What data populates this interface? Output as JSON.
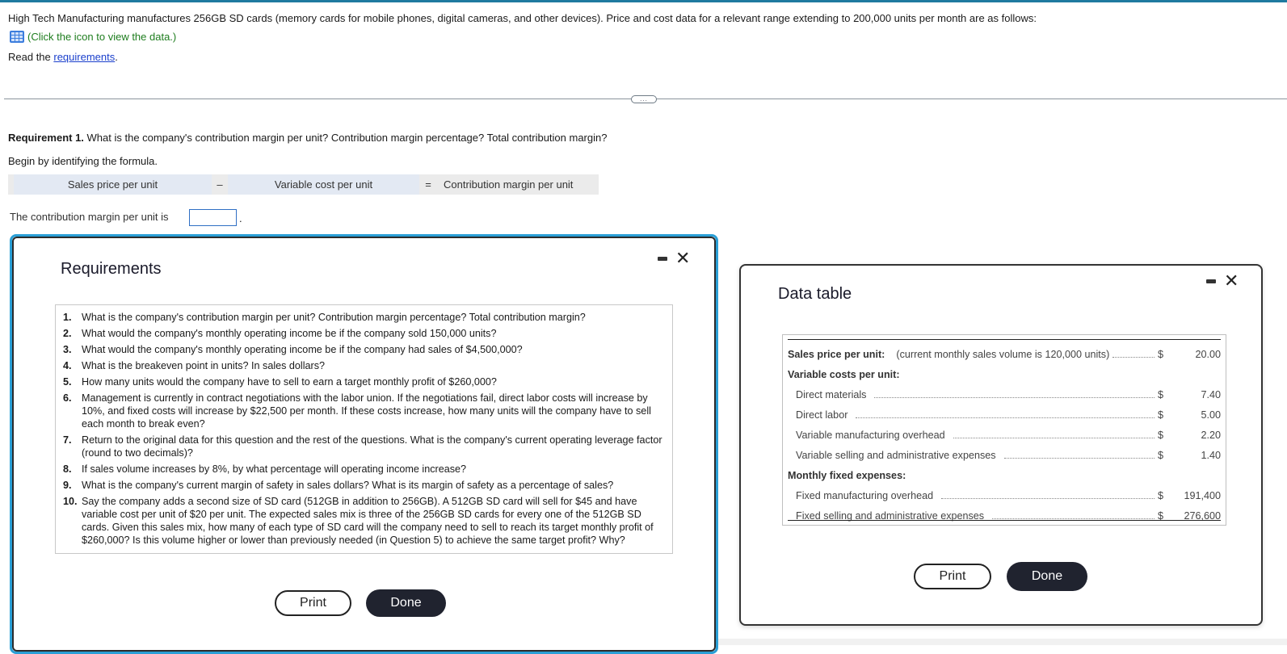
{
  "intro_text": "High Tech Manufacturing manufactures 256GB SD cards (memory cards for mobile phones, digital cameras, and other devices). Price and cost data for a relevant range extending to 200,000 units per month are as follows:",
  "data_link": {
    "icon": "table-grid-icon",
    "label": "(Click the icon to view the data.)"
  },
  "read_requirements": {
    "prefix": "Read the ",
    "link": "requirements",
    "suffix": "."
  },
  "divider_more": "...",
  "requirement1": {
    "label": "Requirement 1.",
    "question": " What is the company's contribution margin per unit? Contribution margin percentage? Total contribution margin?"
  },
  "begin_text": "Begin by identifying the formula.",
  "formula": {
    "term1": "Sales price per unit",
    "op1": "–",
    "term2": "Variable cost per unit",
    "op2": "=",
    "result": "Contribution margin per unit"
  },
  "answer_line": {
    "label": "The contribution margin per unit is",
    "value": "",
    "suffix": "."
  },
  "requirements_modal": {
    "title": "Requirements",
    "items": [
      {
        "num": "1.",
        "text": "What is the company's contribution margin per unit? Contribution margin percentage? Total contribution margin?"
      },
      {
        "num": "2.",
        "text": "What would the company's monthly operating income be if the company sold 150,000 units?"
      },
      {
        "num": "3.",
        "text": "What would the company's monthly operating income be if the company had sales of $4,500,000?"
      },
      {
        "num": "4.",
        "text": "What is the breakeven point in units? In sales dollars?"
      },
      {
        "num": "5.",
        "text": "How many units would the company have to sell to earn a target monthly profit of $260,000?"
      },
      {
        "num": "6.",
        "text": "Management is currently in contract negotiations with the labor union. If the negotiations fail, direct labor costs will increase by 10%, and fixed costs will increase by $22,500 per month. If these costs increase, how many units will the company have to sell each month to break even?"
      },
      {
        "num": "7.",
        "text": "Return to the original data for this question and the rest of the questions. What is the company's current operating leverage factor (round to two decimals)?"
      },
      {
        "num": "8.",
        "text": "If sales volume increases by 8%, by what percentage will operating income increase?"
      },
      {
        "num": "9.",
        "text": "What is the company's current margin of safety in sales dollars? What is its margin of safety as a percentage of sales?"
      },
      {
        "num": "10.",
        "text": "Say the company adds a second size of SD card (512GB in addition to 256GB). A 512GB SD card will sell for $45 and have variable cost per unit of $20 per unit. The expected sales mix is three of the 256GB SD cards for every one of the 512GB SD cards. Given this sales mix, how many of each type of SD card will the company need to sell to reach its target monthly profit of $260,000? Is this volume higher or lower than previously needed (in Question 5) to achieve the same target profit? Why?"
      }
    ],
    "print_label": "Print",
    "done_label": "Done"
  },
  "data_modal": {
    "title": "Data table",
    "sales_price": {
      "label": "Sales price per unit:",
      "note": "(current monthly sales volume is 120,000 units)",
      "currency": "$",
      "value": "20.00"
    },
    "variable_header": "Variable costs per unit:",
    "variable_costs": [
      {
        "label": "Direct materials",
        "currency": "$",
        "value": "7.40"
      },
      {
        "label": "Direct labor",
        "currency": "$",
        "value": "5.00"
      },
      {
        "label": "Variable manufacturing overhead",
        "currency": "$",
        "value": "2.20"
      },
      {
        "label": "Variable selling and administrative expenses",
        "currency": "$",
        "value": "1.40"
      }
    ],
    "fixed_header": "Monthly fixed expenses:",
    "fixed_costs": [
      {
        "label": "Fixed manufacturing overhead",
        "currency": "$",
        "value": "191,400"
      },
      {
        "label": "Fixed selling and administrative expenses",
        "currency": "$",
        "value": "276,600"
      }
    ],
    "print_label": "Print",
    "done_label": "Done"
  },
  "colors": {
    "accent": "#2a9fd6",
    "link": "#1a3fcc",
    "hint_green": "#1e7d1e",
    "done_button": "#20232f"
  }
}
